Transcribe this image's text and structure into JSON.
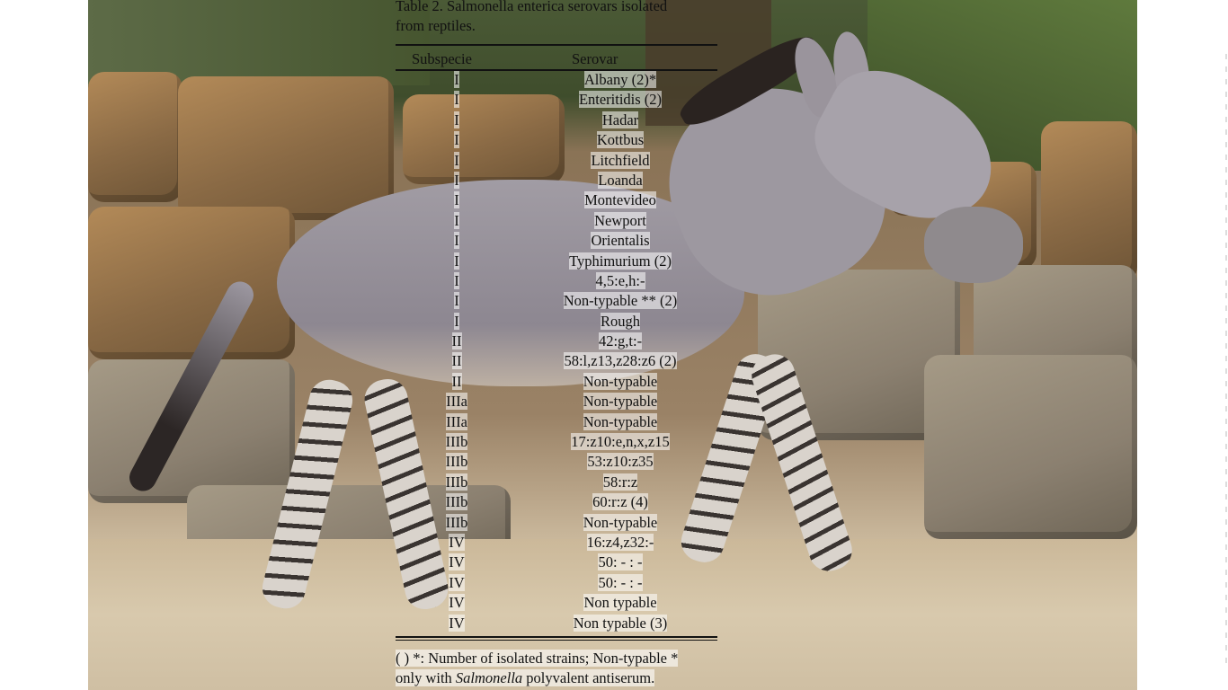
{
  "document": {
    "title_lines": [
      "Table 2. Salmonella enterica serovars isolated",
      "from reptiles."
    ],
    "columns": [
      "Subspecie",
      "Serovar"
    ],
    "rows": [
      {
        "subspecies": "I",
        "serovar": "Albany (2)*"
      },
      {
        "subspecies": "I",
        "serovar": "Enteritidis (2)"
      },
      {
        "subspecies": "I",
        "serovar": "Hadar"
      },
      {
        "subspecies": "I",
        "serovar": "Kottbus"
      },
      {
        "subspecies": "I",
        "serovar": "Litchfield"
      },
      {
        "subspecies": "I",
        "serovar": "Loanda"
      },
      {
        "subspecies": "I",
        "serovar": "Montevideo"
      },
      {
        "subspecies": "I",
        "serovar": "Newport"
      },
      {
        "subspecies": "I",
        "serovar": "Orientalis"
      },
      {
        "subspecies": "I",
        "serovar": "Typhimurium (2)"
      },
      {
        "subspecies": "I",
        "serovar": "4,5:e,h:-"
      },
      {
        "subspecies": "I",
        "serovar": "Non-typable ** (2)"
      },
      {
        "subspecies": "I",
        "serovar": "Rough"
      },
      {
        "subspecies": "II",
        "serovar": "42:g,t:-"
      },
      {
        "subspecies": "II",
        "serovar": "58:l,z13,z28:z6 (2)"
      },
      {
        "subspecies": "II",
        "serovar": "Non-typable"
      },
      {
        "subspecies": "IIIa",
        "serovar": "Non-typable"
      },
      {
        "subspecies": "IIIa",
        "serovar": "Non-typable"
      },
      {
        "subspecies": "IIIb",
        "serovar": "17:z10:e,n,x,z15"
      },
      {
        "subspecies": "IIIb",
        "serovar": "53:z10:z35"
      },
      {
        "subspecies": "IIIb",
        "serovar": "58:r:z"
      },
      {
        "subspecies": "IIIb",
        "serovar": "60:r:z (4)"
      },
      {
        "subspecies": "IIIb",
        "serovar": "Non-typable"
      },
      {
        "subspecies": "IV",
        "serovar": "16:z4,z32:-"
      },
      {
        "subspecies": "IV",
        "serovar": "50: - : -"
      },
      {
        "subspecies": "IV",
        "serovar": "50: - : -"
      },
      {
        "subspecies": "IV",
        "serovar": "Non typable"
      },
      {
        "subspecies": "IV",
        "serovar": "Non typable (3)"
      }
    ],
    "footnote_line1": "( ) *: Number of isolated strains; Non-typable *",
    "footnote_line2_pre": "only with ",
    "footnote_line2_italic": "Salmonella",
    "footnote_line2_post": " polyvalent antiserum."
  },
  "photo": {
    "subject": "wild-ass",
    "colors": {
      "rock": "#8a6a45",
      "ground": "#d6c6aa",
      "coat": "#9d98a0"
    }
  }
}
